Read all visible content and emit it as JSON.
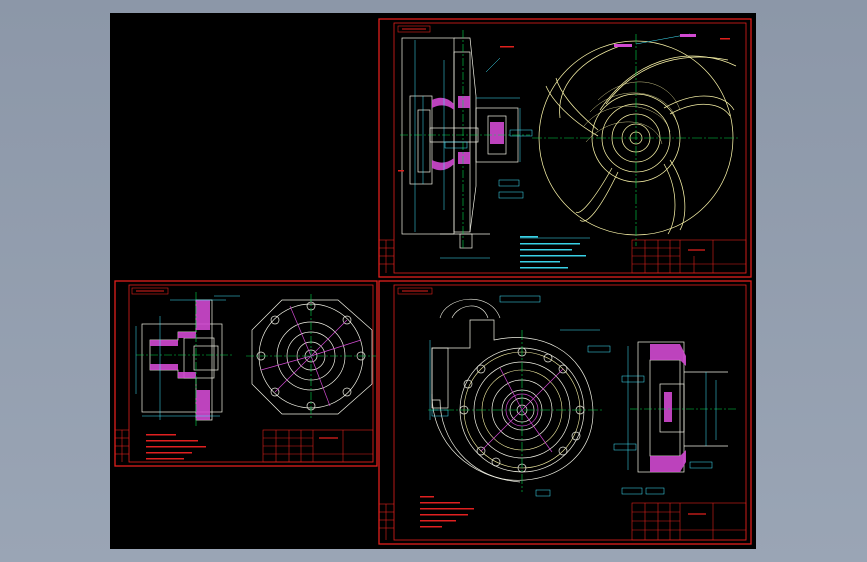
{
  "colors": {
    "background": "#8c97a8",
    "canvas": "#000000",
    "frame": "#e0201c",
    "geometry": "#f2f2e6",
    "center_line": "#00d84a",
    "dimension": "#40e8ff",
    "hatch": "#d14ad1",
    "note_text": "#e02020",
    "wheel": "#f7f1a6"
  },
  "sheets": [
    {
      "name": "sheet-impeller",
      "type": "impeller-drawing"
    },
    {
      "name": "sheet-pump-cover",
      "type": "cover-drawing"
    },
    {
      "name": "sheet-pump-casing",
      "type": "casing-drawing"
    }
  ]
}
